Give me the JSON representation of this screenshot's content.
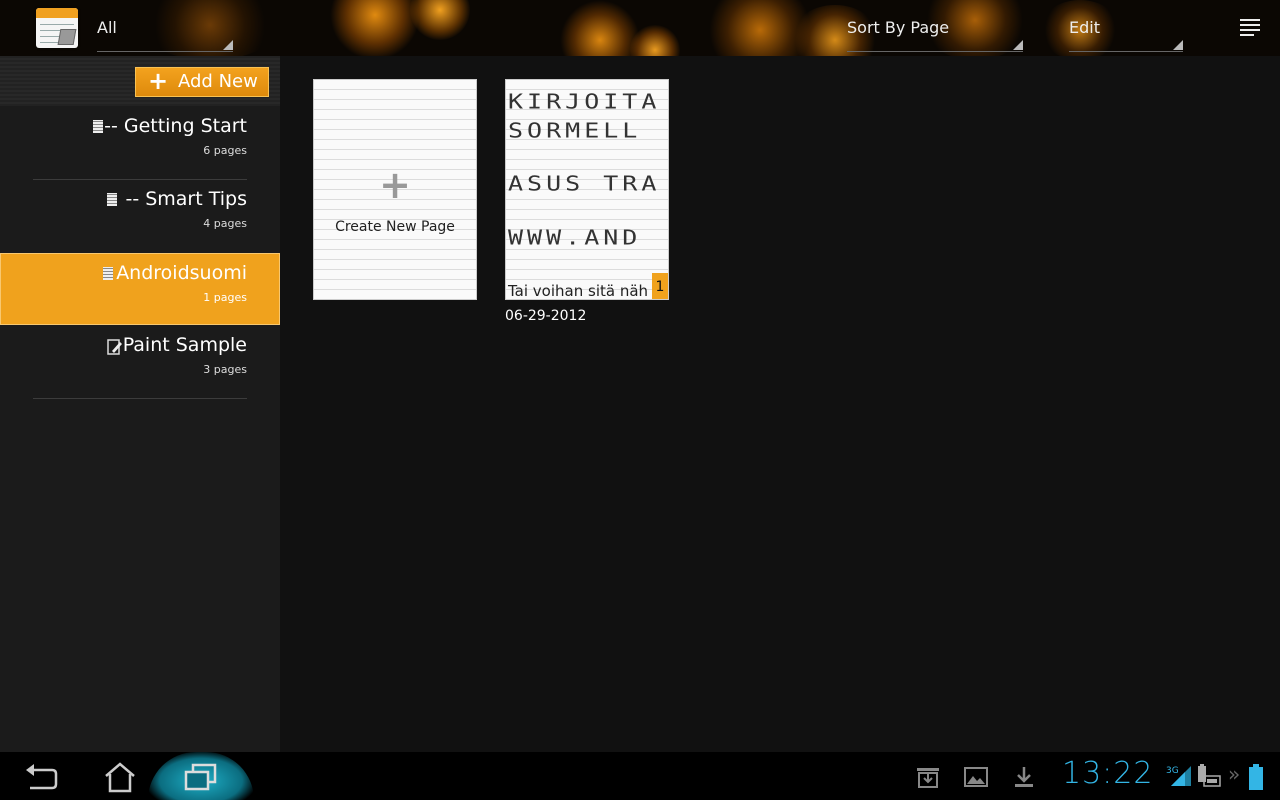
{
  "action_bar": {
    "filter_value": "All",
    "sort_value": "Sort By Page",
    "edit_value": "Edit"
  },
  "sidebar": {
    "add_new_label": "Add New",
    "items": [
      {
        "title": "-- Getting Start",
        "count": "6 pages",
        "selected": false,
        "icon": "notebook-icon"
      },
      {
        "title": "-- Smart Tips",
        "count": "4 pages",
        "selected": false,
        "icon": "notebook-icon"
      },
      {
        "title": "Androidsuomi",
        "count": "1 pages",
        "selected": true,
        "icon": "notebook-icon"
      },
      {
        "title": "Paint Sample",
        "count": "3 pages",
        "selected": false,
        "icon": "paint-notebook-icon"
      }
    ]
  },
  "main": {
    "create_label": "Create New Page",
    "page": {
      "handwriting": [
        "KIRJOITA",
        "SORMELL",
        "ASUS TRA",
        "WWW.AND"
      ],
      "typed": "Tai voihan sitä näh",
      "number": "1",
      "date": "06-29-2012"
    }
  },
  "status_bar": {
    "time": "13:22",
    "network": "3G"
  },
  "colors": {
    "accent": "#f0a21d",
    "clock": "#33b5e5"
  }
}
